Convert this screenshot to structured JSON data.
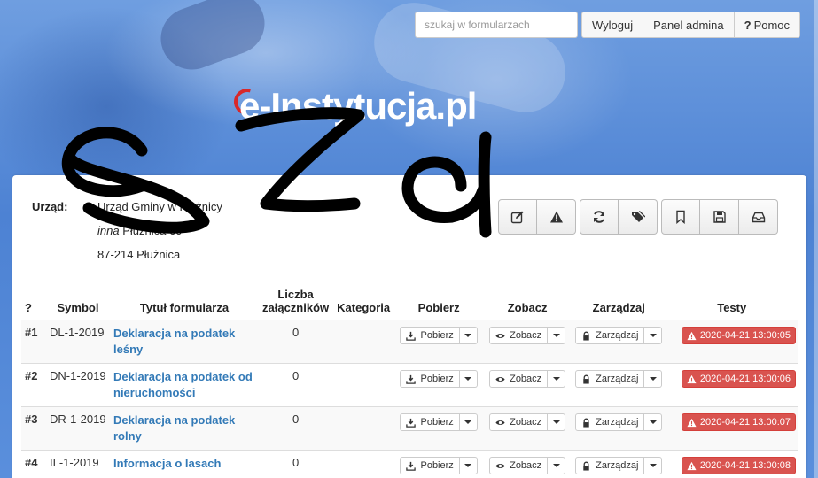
{
  "header": {
    "search_placeholder": "szukaj w formularzach",
    "buttons": {
      "logout": "Wyloguj",
      "admin": "Panel admina",
      "help_mark": "?",
      "help": "Pomoc"
    },
    "logo": "e-Instytucja.pl"
  },
  "office": {
    "label": "Urząd:",
    "name": "Urząd Gminy w Płużnicy",
    "address_prefix": "inna",
    "address": "Płużnica 60",
    "postal": "87-214 Płużnica"
  },
  "toolbar_icons": [
    "edit-icon",
    "warning-icon",
    "refresh-icon",
    "tags-icon",
    "bookmark-icon",
    "save-icon",
    "inbox-icon"
  ],
  "table": {
    "headers": {
      "num": "?",
      "symbol": "Symbol",
      "title": "Tytuł formularza",
      "attachments_1": "Liczba",
      "attachments_2": "załączników",
      "category": "Kategoria",
      "download": "Pobierz",
      "view": "Zobacz",
      "manage": "Zarządzaj",
      "tests": "Testy"
    },
    "rows": [
      {
        "num": "#1",
        "symbol": "DL-1-2019",
        "title": "Deklaracja na podatek leśny",
        "attachments": "0",
        "category": "",
        "download": "Pobierz",
        "view": "Zobacz",
        "manage": "Zarządzaj",
        "test": "2020-04-21 13:00:05"
      },
      {
        "num": "#2",
        "symbol": "DN-1-2019",
        "title": "Deklaracja na podatek od nieruchomości",
        "attachments": "0",
        "category": "",
        "download": "Pobierz",
        "view": "Zobacz",
        "manage": "Zarządzaj",
        "test": "2020-04-21 13:00:06"
      },
      {
        "num": "#3",
        "symbol": "DR-1-2019",
        "title": "Deklaracja na podatek rolny",
        "attachments": "0",
        "category": "",
        "download": "Pobierz",
        "view": "Zobacz",
        "manage": "Zarządzaj",
        "test": "2020-04-21 13:00:07"
      },
      {
        "num": "#4",
        "symbol": "IL-1-2019",
        "title": "Informacja o lasach",
        "attachments": "0",
        "category": "",
        "download": "Pobierz",
        "view": "Zobacz",
        "manage": "Zarządzaj",
        "test": "2020-04-21 13:00:08"
      }
    ]
  },
  "colors": {
    "link": "#337ab7",
    "danger": "#d9534f",
    "hero": "#4d82d3"
  }
}
